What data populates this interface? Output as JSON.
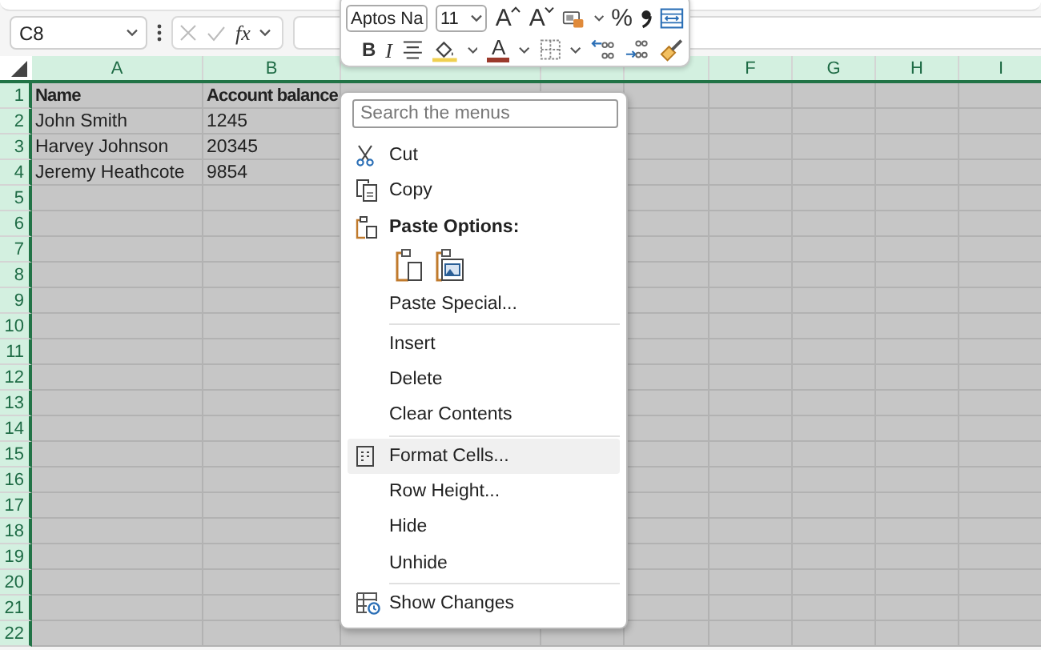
{
  "formula_bar": {
    "name_box": "C8",
    "function_label": "fx"
  },
  "mini_toolbar": {
    "font": "Aptos Na",
    "size": "11",
    "row_1": [
      {
        "kind": "grow-font",
        "glyph": "A"
      },
      {
        "kind": "shrink-font",
        "glyph": "A"
      },
      {
        "kind": "number-format"
      },
      {
        "kind": "percent",
        "glyph": "%"
      },
      {
        "kind": "comma"
      },
      {
        "kind": "wrap"
      }
    ],
    "row_2": [
      {
        "kind": "bold",
        "glyph": "B"
      },
      {
        "kind": "italic",
        "glyph": "I"
      },
      {
        "kind": "align"
      },
      {
        "kind": "fill-color",
        "color": "#f0d050"
      },
      {
        "kind": "font-color",
        "glyph": "A",
        "color": "#9b3a2c"
      },
      {
        "kind": "borders"
      },
      {
        "kind": "decrease-decimal"
      },
      {
        "kind": "increase-decimal"
      },
      {
        "kind": "format-painter"
      }
    ]
  },
  "sheet": {
    "columns": [
      {
        "label": "A",
        "selected": true
      },
      {
        "label": "B",
        "selected": true
      },
      {
        "selected": true
      },
      {
        "selected": true
      },
      {
        "selected": true
      },
      {
        "label": "F",
        "selected": true
      },
      {
        "label": "G",
        "selected": true
      },
      {
        "label": "H",
        "selected": true
      },
      {
        "label": "I",
        "selected": true
      }
    ],
    "rows": [
      {
        "header": "1",
        "selected": true,
        "bold": true,
        "cells": [
          "Name",
          "Account balance"
        ]
      },
      {
        "header": "2",
        "selected": true,
        "bold": false,
        "cells": [
          "John Smith",
          "1245"
        ]
      },
      {
        "header": "3",
        "selected": true,
        "bold": false,
        "cells": [
          "Harvey Johnson",
          "20345"
        ]
      },
      {
        "header": "4",
        "selected": true,
        "bold": false,
        "cells": [
          "Jeremy Heathcote",
          "9854"
        ]
      },
      {
        "header": "5",
        "selected": true
      },
      {
        "header": "6",
        "selected": true
      },
      {
        "header": "7",
        "selected": true
      },
      {
        "header": "8",
        "selected": true
      },
      {
        "header": "9",
        "selected": true
      },
      {
        "header": "10",
        "selected": true
      },
      {
        "header": "11",
        "selected": true
      },
      {
        "header": "12",
        "selected": true
      },
      {
        "header": "13",
        "selected": true
      },
      {
        "header": "14",
        "selected": true
      },
      {
        "header": "15",
        "selected": true
      },
      {
        "header": "16",
        "selected": true
      },
      {
        "header": "17",
        "selected": true
      },
      {
        "header": "18",
        "selected": true
      },
      {
        "header": "19",
        "selected": true
      },
      {
        "header": "20",
        "selected": true
      },
      {
        "header": "21",
        "selected": true
      },
      {
        "header": "22",
        "selected": true
      }
    ]
  },
  "context_menu": {
    "search": {
      "placeholder": "Search the menus"
    },
    "items": [
      {
        "kind": "item",
        "label": "Cut",
        "highlighted": false
      },
      {
        "kind": "item",
        "label": "Copy",
        "highlighted": false
      },
      {
        "kind": "heading",
        "label": "Paste Options:"
      },
      {
        "kind": "paste-icons"
      },
      {
        "kind": "item",
        "label": "Paste Special...",
        "highlighted": false
      },
      {
        "kind": "separator"
      },
      {
        "kind": "item",
        "label": "Insert",
        "highlighted": false
      },
      {
        "kind": "item",
        "label": "Delete",
        "highlighted": false
      },
      {
        "kind": "item",
        "label": "Clear Contents",
        "highlighted": false
      },
      {
        "kind": "separator"
      },
      {
        "kind": "item",
        "label": "Format Cells...",
        "highlighted": true
      },
      {
        "kind": "item",
        "label": "Row Height...",
        "highlighted": false
      },
      {
        "kind": "item",
        "label": "Hide",
        "highlighted": false
      },
      {
        "kind": "item",
        "label": "Unhide",
        "highlighted": false
      },
      {
        "kind": "separator"
      },
      {
        "kind": "item",
        "label": "Show Changes",
        "highlighted": false
      }
    ]
  }
}
